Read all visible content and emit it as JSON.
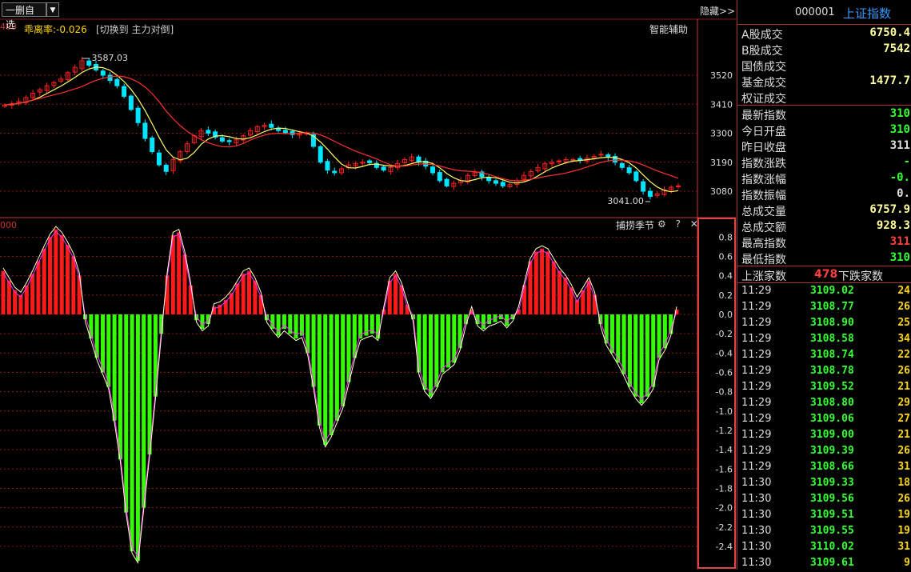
{
  "toolbar": {
    "watch_select": "一删自选",
    "hide_label": "隐藏>>"
  },
  "main_chart": {
    "deviation_label": "乖离率:-0.026",
    "switch_label": "[切换到 主力对倒]",
    "assist_label": "智能辅助",
    "left_edge_value": "400",
    "price_axis": [
      "3520",
      "3410",
      "3300",
      "3190",
      "3080"
    ],
    "high_annotation": "3587.03",
    "low_annotation": "3041.00",
    "colors": {
      "up": "#ff2020",
      "down": "#00e5ff",
      "ma_short": "#ffff66",
      "ma_long": "#ff3030",
      "grid": "#8b1a1a"
    }
  },
  "indicator": {
    "title": "捕捞季节",
    "tools": "⚙ ? ✕",
    "left_edge_value": "000",
    "axis": [
      "0.8",
      "0.6",
      "0.4",
      "0.2",
      "0.0",
      "-0.2",
      "-0.4",
      "-0.6",
      "-0.8",
      "-1.0",
      "-1.2",
      "-1.4",
      "-1.6",
      "-1.8",
      "-2.0",
      "-2.2",
      "-2.4"
    ],
    "colors": {
      "pos": "#ff1a1a",
      "neg": "#33ff00",
      "line1": "#ffffcc",
      "line2": "#ff33ff"
    }
  },
  "chart_data": [
    {
      "type": "candlestick",
      "title": "",
      "y_axis_ticks": [
        3520,
        3410,
        3300,
        3190,
        3080
      ],
      "annotations": [
        {
          "text": "3587.03",
          "kind": "high"
        },
        {
          "text": "3041.00",
          "kind": "low"
        }
      ],
      "series": [
        {
          "values": [
            3407,
            3412,
            3420,
            3435,
            3452,
            3465,
            3480,
            3492,
            3505,
            3530,
            3550,
            3575,
            3558,
            3540,
            3520,
            3500,
            3480,
            3440,
            3390,
            3340,
            3280,
            3230,
            3180,
            3155,
            3200,
            3230,
            3260,
            3290,
            3310,
            3300,
            3285,
            3270,
            3268,
            3275,
            3290,
            3310,
            3325,
            3330,
            3322,
            3310,
            3302,
            3295,
            3298,
            3300,
            3250,
            3190,
            3160,
            3150,
            3165,
            3180,
            3185,
            3190,
            3188,
            3170,
            3160,
            3170,
            3185,
            3200,
            3210,
            3190,
            3175,
            3150,
            3120,
            3100,
            3110,
            3120,
            3140,
            3150,
            3135,
            3120,
            3110,
            3100,
            3105,
            3120,
            3140,
            3155,
            3170,
            3185,
            3190,
            3195,
            3200,
            3200,
            3198,
            3205,
            3212,
            3220,
            3210,
            3190,
            3170,
            3150,
            3120,
            3080,
            3060,
            3070,
            3085,
            3095,
            3100
          ]
        }
      ]
    },
    {
      "type": "bar",
      "title": "捕捞季节",
      "ylim": [
        -2.5,
        0.9
      ],
      "values": [
        0.45,
        0.35,
        0.25,
        0.2,
        0.3,
        0.42,
        0.55,
        0.68,
        0.8,
        0.88,
        0.82,
        0.72,
        0.6,
        0.4,
        -0.05,
        -0.25,
        -0.45,
        -0.6,
        -0.75,
        -1.1,
        -1.5,
        -2.05,
        -2.45,
        -2.55,
        -2.0,
        -1.45,
        -0.85,
        -0.2,
        0.4,
        0.82,
        0.85,
        0.62,
        0.3,
        -0.06,
        -0.15,
        -0.1,
        0.08,
        0.1,
        0.15,
        0.22,
        0.32,
        0.42,
        0.45,
        0.35,
        0.2,
        -0.06,
        -0.15,
        -0.22,
        -0.15,
        -0.2,
        -0.25,
        -0.22,
        -0.4,
        -0.75,
        -1.15,
        -1.35,
        -1.25,
        -1.1,
        -0.95,
        -0.7,
        -0.45,
        -0.25,
        -0.22,
        -0.2,
        -0.25,
        0.05,
        0.35,
        0.42,
        0.3,
        0.1,
        -0.05,
        -0.6,
        -0.78,
        -0.85,
        -0.75,
        -0.6,
        -0.55,
        -0.5,
        -0.35,
        -0.1,
        0.05,
        -0.1,
        -0.15,
        -0.1,
        -0.08,
        -0.05,
        -0.12,
        -0.05,
        0.05,
        0.3,
        0.55,
        0.65,
        0.68,
        0.65,
        0.55,
        0.45,
        0.38,
        0.28,
        0.15,
        0.25,
        0.35,
        0.2,
        -0.1,
        -0.3,
        -0.4,
        -0.5,
        -0.62,
        -0.75,
        -0.85,
        -0.92,
        -0.85,
        -0.75,
        -0.45,
        -0.35,
        -0.2,
        0.05
      ]
    }
  ],
  "quote_panel": {
    "code": "000001",
    "name": "上证指数",
    "fields": [
      {
        "label": "A股成交",
        "value": "6750.4",
        "color": "#ffffa0"
      },
      {
        "label": "B股成交",
        "value": "7542",
        "color": "#ffffa0"
      },
      {
        "label": "国债成交",
        "value": "",
        "color": "#ffffa0"
      },
      {
        "label": "基金成交",
        "value": "1477.7",
        "color": "#ffffa0"
      },
      {
        "label": "权证成交",
        "value": "",
        "color": "#ffffa0"
      },
      {
        "label": "最新指数",
        "value": "310",
        "color": "#33ff33"
      },
      {
        "label": "今日开盘",
        "value": "310",
        "color": "#33ff33"
      },
      {
        "label": "昨日收盘",
        "value": "311",
        "color": "#dddddd"
      },
      {
        "label": "指数涨跌",
        "value": "-",
        "color": "#33ff33"
      },
      {
        "label": "指数涨幅",
        "value": "-0.",
        "color": "#33ff33"
      },
      {
        "label": "指数振幅",
        "value": "0.",
        "color": "#dddddd"
      },
      {
        "label": "总成交量",
        "value": "6757.9",
        "color": "#ffffa0"
      },
      {
        "label": "总成交额",
        "value": "928.3",
        "color": "#ffffa0"
      },
      {
        "label": "最高指数",
        "value": "311",
        "color": "#ff4040"
      },
      {
        "label": "最低指数",
        "value": "310",
        "color": "#33ff33"
      }
    ],
    "breadth": {
      "up_label": "上涨家数",
      "up_count": "478",
      "down_label": "下跌家数"
    },
    "ticks": [
      {
        "time": "11:29",
        "price": "3109.02",
        "vol": "24"
      },
      {
        "time": "11:29",
        "price": "3108.77",
        "vol": "26"
      },
      {
        "time": "11:29",
        "price": "3108.90",
        "vol": "25"
      },
      {
        "time": "11:29",
        "price": "3108.58",
        "vol": "34"
      },
      {
        "time": "11:29",
        "price": "3108.74",
        "vol": "22"
      },
      {
        "time": "11:29",
        "price": "3108.78",
        "vol": "26"
      },
      {
        "time": "11:29",
        "price": "3109.52",
        "vol": "21"
      },
      {
        "time": "11:29",
        "price": "3108.80",
        "vol": "29"
      },
      {
        "time": "11:29",
        "price": "3109.06",
        "vol": "27"
      },
      {
        "time": "11:29",
        "price": "3109.00",
        "vol": "21"
      },
      {
        "time": "11:29",
        "price": "3109.39",
        "vol": "26"
      },
      {
        "time": "11:29",
        "price": "3108.66",
        "vol": "31"
      },
      {
        "time": "11:30",
        "price": "3109.33",
        "vol": "18"
      },
      {
        "time": "11:30",
        "price": "3109.56",
        "vol": "26"
      },
      {
        "time": "11:30",
        "price": "3109.51",
        "vol": "19"
      },
      {
        "time": "11:30",
        "price": "3109.55",
        "vol": "19"
      },
      {
        "time": "11:30",
        "price": "3110.02",
        "vol": "31"
      },
      {
        "time": "11:30",
        "price": "3109.61",
        "vol": "9"
      }
    ]
  }
}
